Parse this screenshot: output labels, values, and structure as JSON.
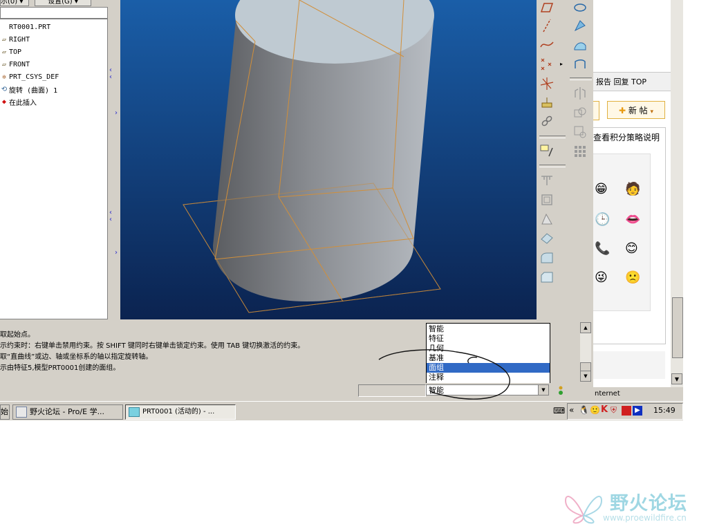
{
  "tree_header": {
    "tab_left": "示(0) ▾",
    "tab_right": "设置(G) ▾"
  },
  "model_tree": {
    "items": [
      {
        "icon": "part-icon",
        "label": "RT0001.PRT"
      },
      {
        "icon": "datum-plane-icon",
        "label": "RIGHT"
      },
      {
        "icon": "datum-plane-icon",
        "label": "TOP"
      },
      {
        "icon": "datum-plane-icon",
        "label": "FRONT"
      },
      {
        "icon": "csys-icon",
        "label": "PRT_CSYS_DEF"
      },
      {
        "icon": "revolve-icon",
        "label": "旋转 (曲面) 1"
      },
      {
        "icon": "insert-here-icon",
        "label": "在此插入"
      }
    ]
  },
  "browser": {
    "links": "报告 回复 TOP",
    "new_post": "新 帖",
    "policy_text": "查看积分策略说明",
    "status_fragment": "nternet"
  },
  "messages": [
    "取起始点。",
    "示约束时：右键单击禁用约束。按 SHIFT 键同时右键单击锁定约束。使用 TAB 键切换激活的约束。",
    "取“直曲线”或边、轴或坐标系的轴以指定旋转轴。",
    "示由特征5,模型PRT0001创建的面组。"
  ],
  "filter": {
    "options": [
      "智能",
      "特征",
      "几何",
      "基准",
      "面组",
      "注释"
    ],
    "selected_index": 4,
    "current": "智能"
  },
  "taskbar": {
    "start_fragment": "始",
    "tasks": [
      {
        "label": "野火论坛 - Pro/E 学..."
      },
      {
        "label": "PRT0001 (活动的) - ..."
      }
    ],
    "clock": "15:49"
  },
  "watermark": {
    "name": "野火论坛",
    "url": "www.proewildfire.cn"
  },
  "colors": {
    "viewport_top": "#1a5ea8",
    "viewport_bottom": "#0b2350",
    "highlight": "#316ac5",
    "model_edge": "#d18f3a"
  }
}
